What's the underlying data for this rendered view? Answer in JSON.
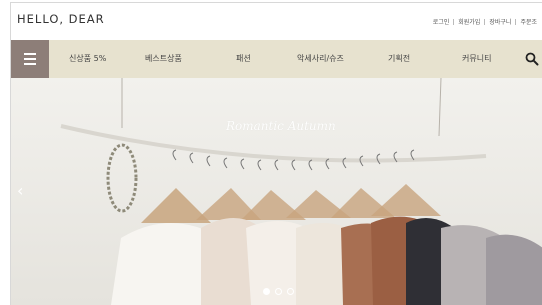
{
  "header": {
    "logo": "HELLO, DEAR",
    "util_links": [
      "로그인",
      "회원가입",
      "장바구니",
      "주문조"
    ]
  },
  "nav": {
    "items": [
      "신상품 5%",
      "베스트상품",
      "패션",
      "악세사리/슈즈",
      "기획전",
      "커뮤니티"
    ]
  },
  "hero": {
    "title": "Romantic Autumn",
    "slides_total": 3,
    "active_slide": 1
  },
  "colors": {
    "nav_bg": "#e7e2cf",
    "menu_btn": "#8d7e78"
  },
  "icons": [
    "menu-icon",
    "search-icon",
    "arrow-left-icon"
  ]
}
